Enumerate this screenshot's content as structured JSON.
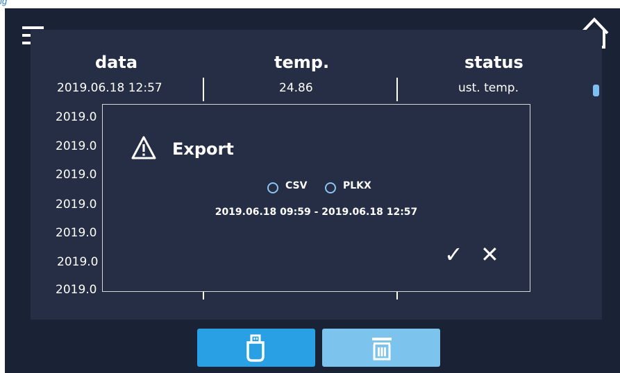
{
  "caption": "ig",
  "table": {
    "headers": [
      "data",
      "temp.",
      "status"
    ],
    "rows": [
      {
        "date": "2019.06.18  12:57",
        "temp": "24.86",
        "status": "ust. temp."
      },
      {
        "date": "2019.0"
      },
      {
        "date": "2019.0"
      },
      {
        "date": "2019.0"
      },
      {
        "date": "2019.0"
      },
      {
        "date": "2019.0"
      },
      {
        "date": "2019.0"
      },
      {
        "date": "2019.0",
        "temp": "",
        "status": ""
      }
    ]
  },
  "dialog": {
    "title": "Export",
    "options": [
      {
        "label": "CSV",
        "selected": false
      },
      {
        "label": "PLKX",
        "selected": false
      }
    ],
    "range": "2019.06.18  09:59 - 2019.06.18  12:57",
    "confirm_symbol": "✓",
    "cancel_symbol": "✕"
  },
  "icons": {
    "menu": "hamburger-icon",
    "home": "home-icon",
    "warning": "warning-icon",
    "usb": "usb-icon",
    "trash": "trash-icon"
  },
  "colors": {
    "screen_bg": "#1a2236",
    "panel_bg": "#252e45",
    "usb_button": "#28a0e3",
    "delete_button": "#7cc4ee",
    "radio_ring": "#8ec6f2"
  }
}
